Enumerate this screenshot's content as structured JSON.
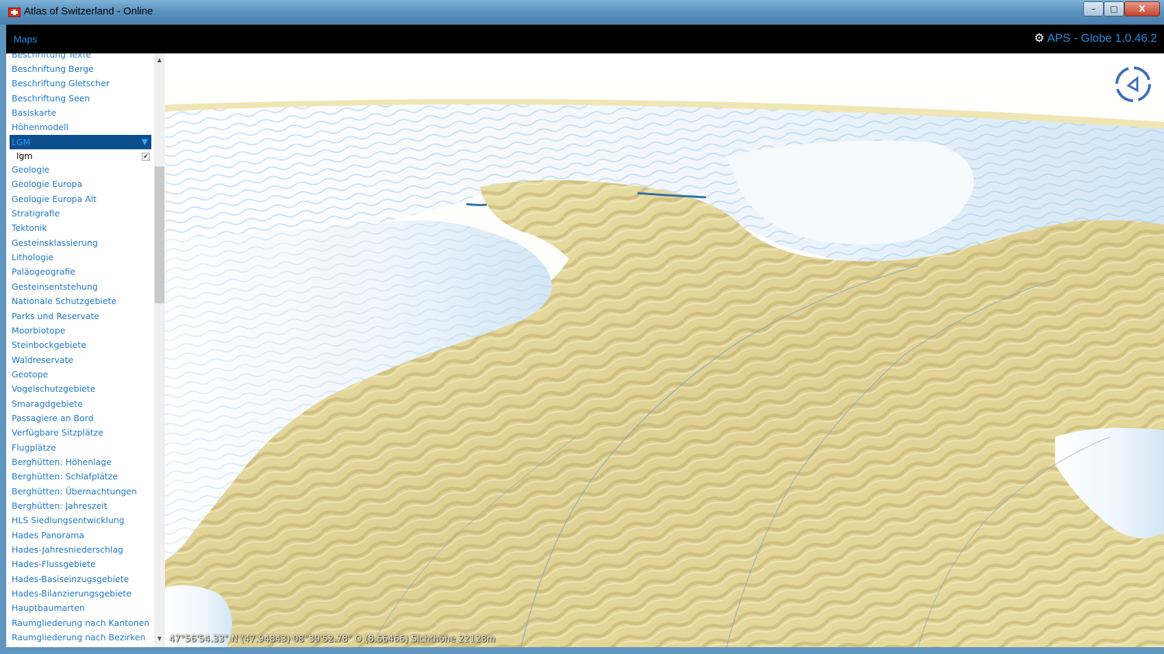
{
  "window": {
    "title": "Atlas of Switzerland - Online",
    "minimize_glyph": "–",
    "maximize_glyph": "□",
    "close_glyph": "X"
  },
  "toolbar": {
    "maps_label": "Maps",
    "version_label": "APS - Globe 1.0.46.2",
    "gear_icon": "⚙"
  },
  "sidebar": {
    "partial_top_item": "Beschriftung Texte",
    "items_before": [
      "Beschriftung Berge",
      "Beschriftung Gletscher",
      "Beschriftung Seen",
      "Basiskarte",
      "Höhenmodell"
    ],
    "selected_group": {
      "label": "LGM",
      "arrow": "▼",
      "sublayer": "lgm",
      "sublayer_checked": true,
      "check_glyph": "✔"
    },
    "items_after": [
      "Geologie",
      "Geologie Europa",
      "Geologie Europa Alt",
      "Stratigrafie",
      "Tektonik",
      "Gesteinsklassierung",
      "Lithologie",
      "Paläogeografie",
      "Gesteinsentstehung",
      "Nationale Schutzgebiete",
      "Parks und Reservate",
      "Moorbiotope",
      "Steinbockgebiete",
      "Waldreservate",
      "Geotope",
      "Vogelschutzgebiete",
      "Smaragdgebiete",
      "Passagiere an Bord",
      "Verfügbare Sitzplätze",
      "Flugplätze",
      "Berghütten: Höhenlage",
      "Berghütten: Schlafplätze",
      "Berghütten: Übernachtungen",
      "Berghütten: Jahreszeit",
      "HLS Siedlungsentwicklung",
      "Hades Panorama",
      "Hades-Jahresniederschlag",
      "Hades-Flussgebiete",
      "Hades-Basiseinzugsgebiete",
      "Hades-Bilanzierungsgebiete",
      "Hauptbaumarten",
      "Raumgliederung nach Kantonen",
      "Raumgliederung nach Bezirken"
    ],
    "scroll_up_glyph": "▲",
    "scroll_down_glyph": "▼"
  },
  "globe": {
    "coordinates": "47°56'54.33\" N (47.94843) 08°39'52.78\" O (8.66466) Sichthöhe 22128m",
    "colors": {
      "terrain": "#e7dca0",
      "terrain_shade": "#b9a866",
      "glacier": "#f4f8fc",
      "glacier_shade": "#b8d6ee",
      "river": "#7f9cb0",
      "compass": "#3b6fb8"
    }
  }
}
